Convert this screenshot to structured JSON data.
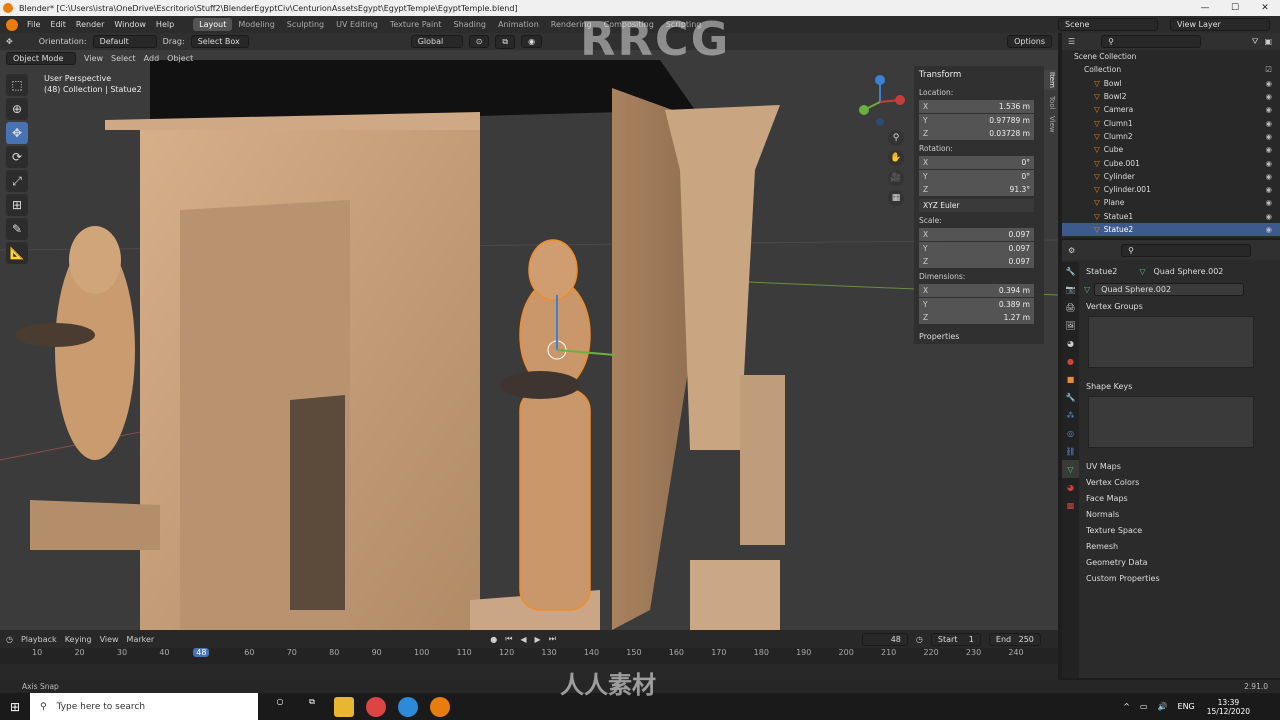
{
  "window": {
    "title": "Blender* [C:\\Users\\istra\\OneDrive\\Escritorio\\Stuff2\\BlenderEgyptCiv\\CenturionAssetsEgypt\\EgyptTemple\\EgyptTemple.blend]"
  },
  "menu": {
    "items": [
      "File",
      "Edit",
      "Render",
      "Window",
      "Help"
    ],
    "workspaces": [
      "Layout",
      "Modeling",
      "Sculpting",
      "UV Editing",
      "Texture Paint",
      "Shading",
      "Animation",
      "Rendering",
      "Compositing",
      "Scripting"
    ],
    "scene": "Scene",
    "view_layer": "View Layer"
  },
  "toolheader": {
    "orientation_label": "Orientation:",
    "orientation": "Default",
    "drag_label": "Drag:",
    "drag": "Select Box",
    "transform": "Global",
    "options": "Options"
  },
  "vpheader": {
    "mode": "Object Mode",
    "view": "View",
    "select": "Select",
    "add": "Add",
    "object": "Object"
  },
  "viewport": {
    "perspective": "User Perspective",
    "collection": "(48) Collection | Statue2"
  },
  "npanel": {
    "title": "Transform",
    "location_label": "Location:",
    "location": [
      {
        "ax": "X",
        "v": "1.536 m"
      },
      {
        "ax": "Y",
        "v": "0.97789 m"
      },
      {
        "ax": "Z",
        "v": "0.03728 m"
      }
    ],
    "rotation_label": "Rotation:",
    "rotation": [
      {
        "ax": "X",
        "v": "0°"
      },
      {
        "ax": "Y",
        "v": "0°"
      },
      {
        "ax": "Z",
        "v": "91.3°"
      }
    ],
    "euler": "XYZ Euler",
    "scale_label": "Scale:",
    "scale": [
      {
        "ax": "X",
        "v": "0.097"
      },
      {
        "ax": "Y",
        "v": "0.097"
      },
      {
        "ax": "Z",
        "v": "0.097"
      }
    ],
    "dimensions_label": "Dimensions:",
    "dimensions": [
      {
        "ax": "X",
        "v": "0.394 m"
      },
      {
        "ax": "Y",
        "v": "0.389 m"
      },
      {
        "ax": "Z",
        "v": "1.27 m"
      }
    ],
    "properties": "Properties",
    "tabs": [
      "Item",
      "Tool",
      "View"
    ]
  },
  "outliner": {
    "root": "Scene Collection",
    "collection": "Collection",
    "items": [
      "Bowl",
      "Bowl2",
      "Camera",
      "Clumn1",
      "Clumn2",
      "Cube",
      "Cube.001",
      "Cylinder",
      "Cylinder.001",
      "Plane",
      "Statue1",
      "Statue2"
    ],
    "selected": "Statue2"
  },
  "props": {
    "object": "Statue2",
    "mesh": "Quad Sphere.002",
    "mesh_field": "Quad Sphere.002",
    "vertex_groups": "Vertex Groups",
    "shape_keys": "Shape Keys",
    "sections": [
      "UV Maps",
      "Vertex Colors",
      "Face Maps",
      "Normals",
      "Texture Space",
      "Remesh",
      "Geometry Data",
      "Custom Properties"
    ]
  },
  "timeline": {
    "playback": "Playback",
    "keying": "Keying",
    "view": "View",
    "marker": "Marker",
    "frame": "48",
    "start_label": "Start",
    "start": "1",
    "end_label": "End",
    "end": "250",
    "ticks": [
      "10",
      "20",
      "30",
      "40",
      "48",
      "60",
      "70",
      "80",
      "90",
      "100",
      "110",
      "120",
      "130",
      "140",
      "150",
      "160",
      "170",
      "180",
      "190",
      "200",
      "210",
      "220",
      "230",
      "240"
    ]
  },
  "status": {
    "left": "Axis Snap",
    "version": "2.91.0"
  },
  "taskbar": {
    "search": "Type here to search",
    "lang": "ENG",
    "time": "13:39",
    "date": "15/12/2020"
  },
  "watermark": {
    "top": "RRCG",
    "bottom": "人人素材"
  }
}
